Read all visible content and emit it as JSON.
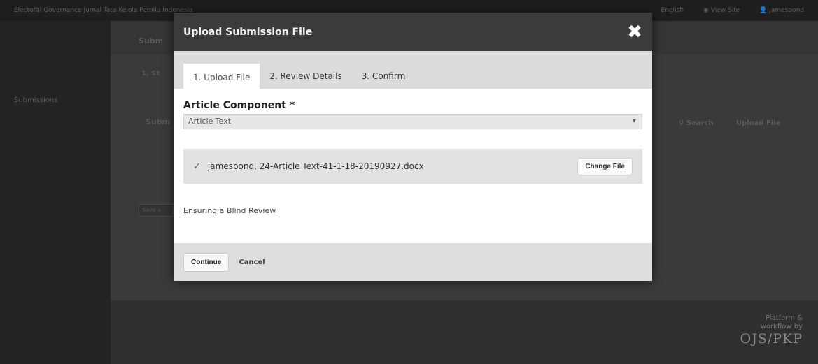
{
  "topbar": {
    "site_title": "Electoral Governance Jurnal Tata Kelola Pemilu Indonesia",
    "language": "English",
    "view_site": "View Site",
    "user": "jamesbond"
  },
  "sidebar": {
    "nav_submissions": "Submissions"
  },
  "background": {
    "heading_fragment": "Subm",
    "tab_fragment": "1. St",
    "section_fragment": "Subm",
    "search_label": "Search",
    "upload_file_label": "Upload File",
    "save_fragment": "Save a"
  },
  "footer": {
    "platform_line1": "Platform &",
    "platform_line2": "workflow by",
    "brand": "OJS/PKP"
  },
  "modal": {
    "title": "Upload Submission File",
    "tabs": [
      {
        "label": "1. Upload File",
        "active": true
      },
      {
        "label": "2. Review Details",
        "active": false
      },
      {
        "label": "3. Confirm",
        "active": false
      }
    ],
    "article_component_label": "Article Component *",
    "article_component_value": "Article Text",
    "file_name": "jamesbond, 24-Article Text-41-1-18-20190927.docx",
    "change_file_label": "Change File",
    "blind_review_link": "Ensuring a Blind Review",
    "continue_label": "Continue",
    "cancel_label": "Cancel"
  },
  "colors": {
    "modal_header": "#3b3b3b",
    "tabs_bar": "#dcdcdc",
    "footer_bar": "#dedede"
  }
}
